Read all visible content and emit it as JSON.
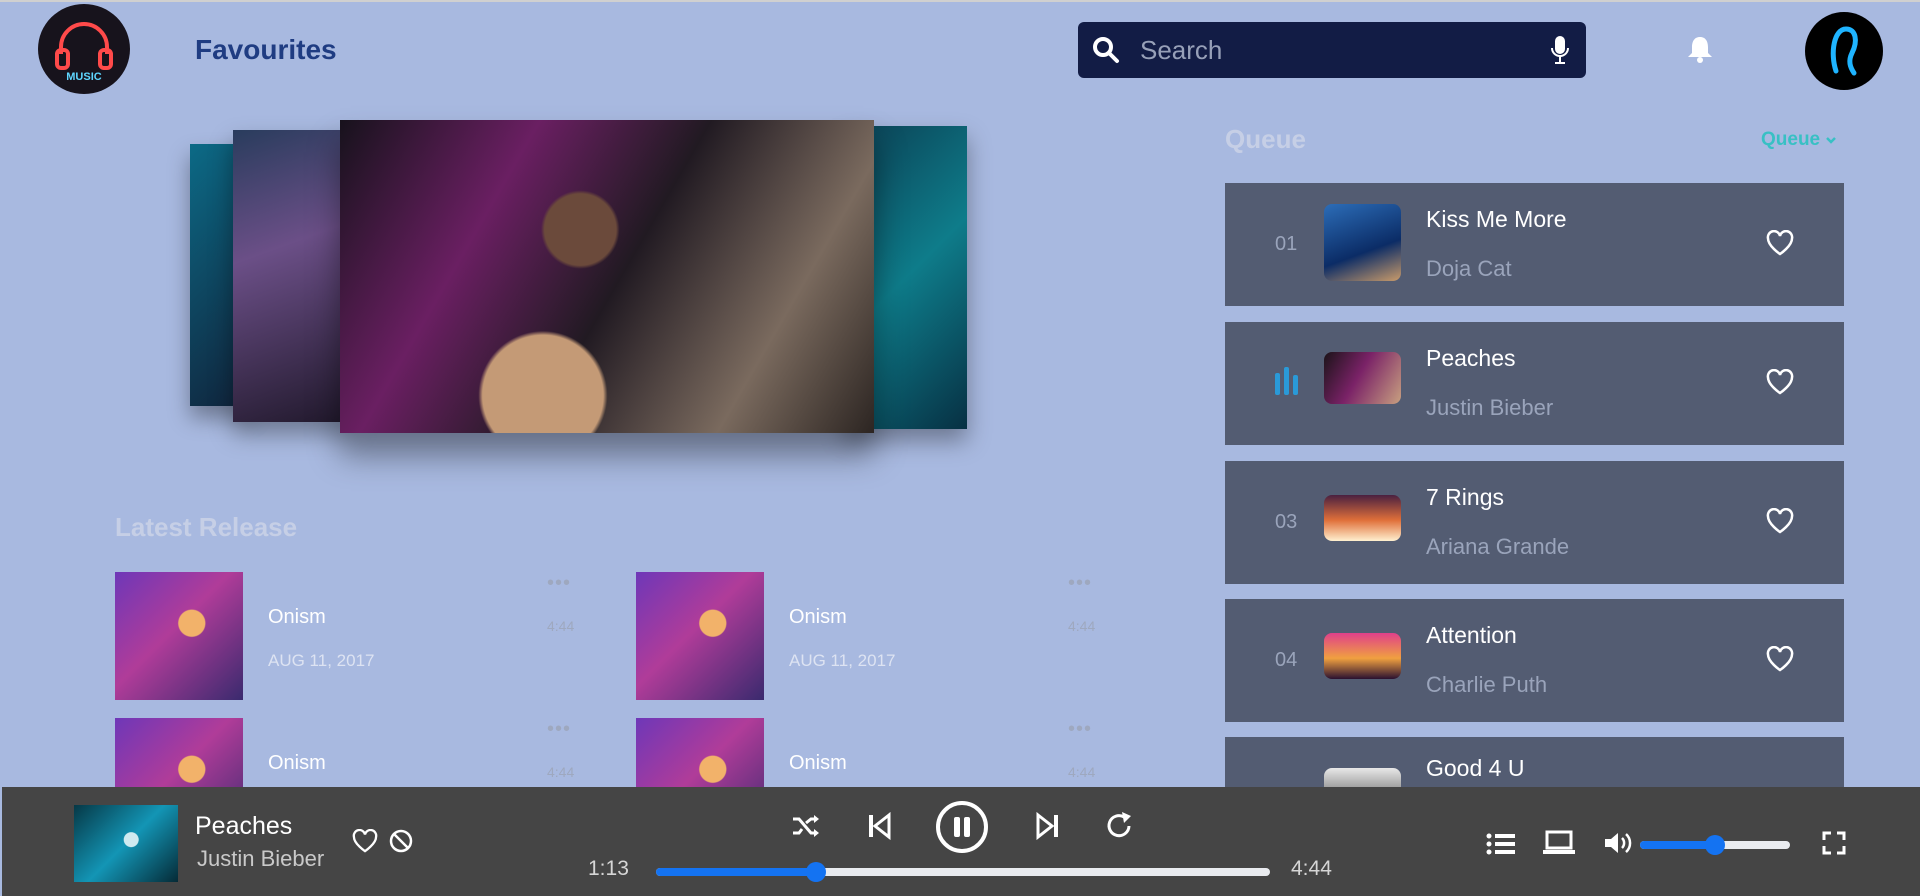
{
  "header": {
    "logo_text": "MUSIC",
    "page_title": "Favourites",
    "search_placeholder": "Search"
  },
  "latest": {
    "title": "Latest Release",
    "items": [
      {
        "name": "Onism",
        "date": "AUG 11, 2017",
        "duration": "4:44",
        "more": "•••"
      },
      {
        "name": "Onism",
        "date": "AUG 11, 2017",
        "duration": "4:44",
        "more": "•••"
      },
      {
        "name": "Onism",
        "date": "",
        "duration": "4:44",
        "more": "•••"
      },
      {
        "name": "Onism",
        "date": "",
        "duration": "4:44",
        "more": "•••"
      }
    ]
  },
  "queue": {
    "title": "Queue",
    "menu_label": "Queue",
    "items": [
      {
        "num": "01",
        "title": "Kiss Me More",
        "artist": "Doja Cat",
        "playing": false
      },
      {
        "num": "",
        "title": "Peaches",
        "artist": "Justin Bieber",
        "playing": true
      },
      {
        "num": "03",
        "title": "7 Rings",
        "artist": "Ariana Grande",
        "playing": false
      },
      {
        "num": "04",
        "title": "Attention",
        "artist": "Charlie Puth",
        "playing": false
      },
      {
        "num": "",
        "title": "Good 4 U",
        "artist": "",
        "playing": false
      }
    ]
  },
  "player": {
    "title": "Peaches",
    "artist": "Justin Bieber",
    "current_time": "1:13",
    "total_time": "4:44",
    "progress": 0.26,
    "volume": 0.5
  },
  "colors": {
    "background": "#a8b9e0",
    "accent": "#1473f2",
    "teal": "#38c0c4",
    "title_blue": "#1f3c82",
    "search_bg": "#121c45",
    "queue_row": "#535c72",
    "player_bg": "#454545"
  },
  "icons": [
    "headphones-logo-icon",
    "search-icon",
    "microphone-icon",
    "bell-icon",
    "user-avatar-icon",
    "chevron-down-icon",
    "equalizer-icon",
    "heart-icon",
    "block-icon",
    "shuffle-icon",
    "previous-icon",
    "pause-icon",
    "next-icon",
    "repeat-icon",
    "list-icon",
    "device-icon",
    "volume-icon",
    "fullscreen-icon"
  ]
}
